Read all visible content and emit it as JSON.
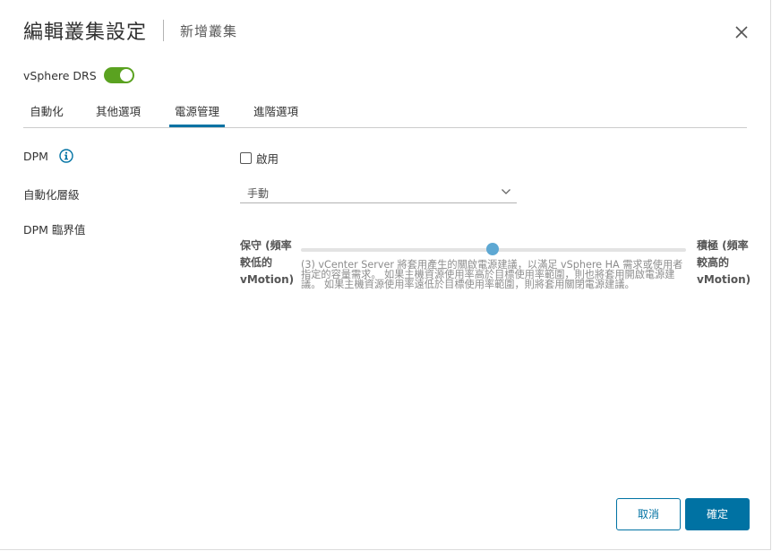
{
  "dialog": {
    "title": "編輯叢集設定",
    "subtitle": "新增叢集"
  },
  "drs": {
    "label": "vSphere DRS",
    "enabled": true
  },
  "tabs": [
    {
      "label": "自動化",
      "active": false
    },
    {
      "label": "其他選項",
      "active": false
    },
    {
      "label": "電源管理",
      "active": true
    },
    {
      "label": "進階選項",
      "active": false
    }
  ],
  "dpm": {
    "label": "DPM",
    "checkbox_label": "啟用",
    "checked": false
  },
  "automation": {
    "label": "自動化層級",
    "value": "手動"
  },
  "threshold": {
    "label": "DPM 臨界值",
    "left_label": "保守 (頻率較低的 vMotion)",
    "right_label": "積極 (頻率較高的 vMotion)",
    "level": 3,
    "description": "(3) vCenter Server 將套用產生的關啟電源建議，以滿足 vSphere HA 需求或使用者指定的容量需求。 如果主機資源使用率高於目標使用率範圍，則也將套用開啟電源建議。 如果主機資源使用率遠低於目標使用率範圍，則將套用關閉電源建議。"
  },
  "buttons": {
    "cancel": "取消",
    "ok": "確定"
  },
  "colors": {
    "accent": "#0072a3",
    "toggle_on": "#5aa220",
    "slider_thumb": "#5ea8d3"
  },
  "icons": {
    "close": "close-icon",
    "info": "info-icon",
    "dropdown": "chevron-down-icon"
  }
}
